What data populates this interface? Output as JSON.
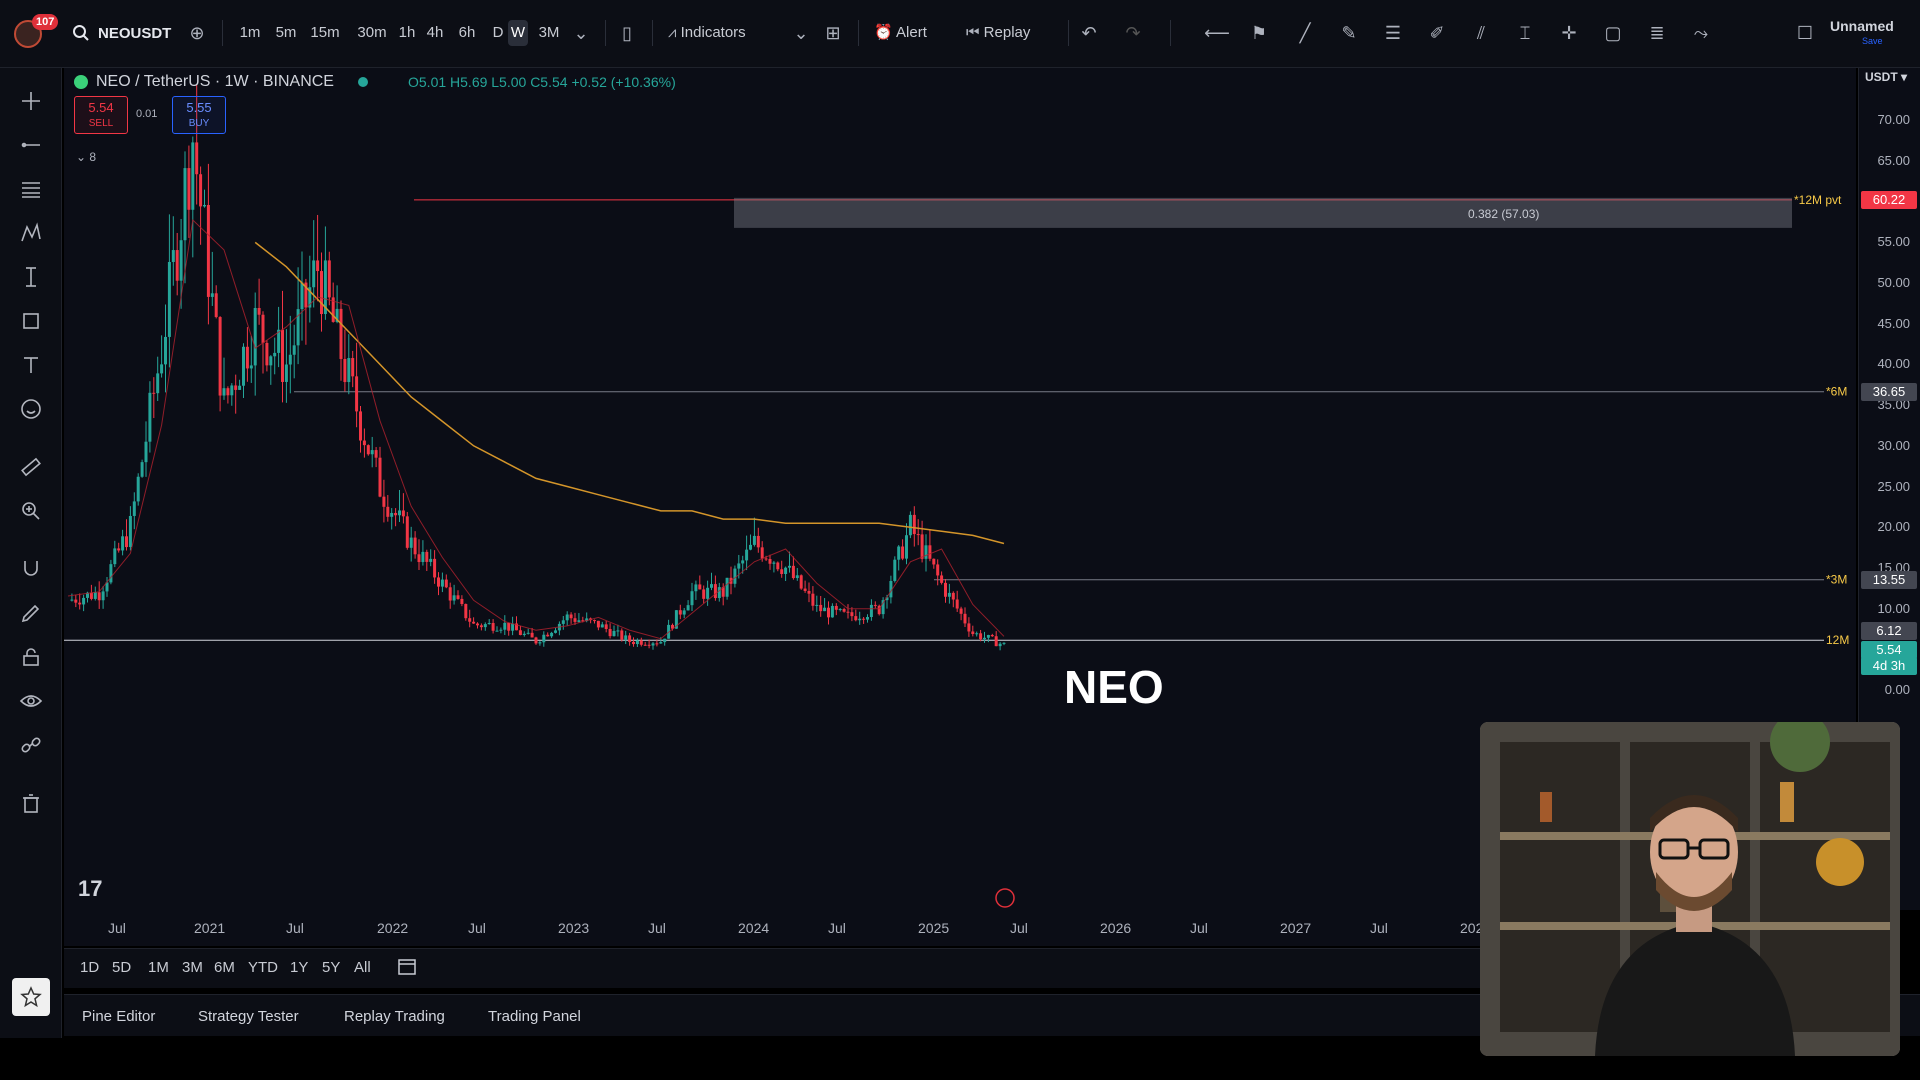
{
  "app": {
    "notification_count": "107",
    "symbol": "NEOUSDT",
    "timeframes": [
      "1m",
      "5m",
      "15m",
      "30m",
      "1h",
      "4h",
      "6h",
      "D",
      "W",
      "3M"
    ],
    "active_timeframe": "W",
    "indicators_label": "Indicators",
    "alert_label": "Alert",
    "replay_label": "Replay",
    "layout_name": "Unnamed",
    "layout_sub": "Save"
  },
  "legend": {
    "title": "NEO / TetherUS · 1W · BINANCE",
    "ohlc": "O5.01 H5.69 L5.00 C5.54 +0.52 (+10.36%)",
    "sell_price": "5.54",
    "sell_label": "SELL",
    "buy_price": "5.55",
    "buy_label": "BUY",
    "spread": "0.01",
    "indicators_collapsed": "8"
  },
  "chart_overlay": {
    "big_label": "NEO",
    "fib_label": "0.382 (57.03)",
    "level_12m_pvt": "*12M pvt",
    "level_6m": "*6M",
    "level_3m": "*3M",
    "level_12m": "12M"
  },
  "price_scale": {
    "currency": "USDT",
    "ticks": [
      "70.00",
      "65.00",
      "60.00",
      "55.00",
      "50.00",
      "45.00",
      "40.00",
      "35.00",
      "30.00",
      "25.00",
      "20.00",
      "15.00",
      "10.00",
      "5.00",
      "0.00"
    ],
    "tags": {
      "pvt_12m": "60.22",
      "lvl_6m": "36.65",
      "lvl_3m": "13.55",
      "lvl_12m": "6.12",
      "last": "5.54",
      "countdown": "4d 3h"
    },
    "colors": {
      "red": "#f23645",
      "green": "#26a69a",
      "gray": "#434651"
    }
  },
  "time_scale": [
    "Jul",
    "2021",
    "Jul",
    "2022",
    "Jul",
    "2023",
    "Jul",
    "2024",
    "Jul",
    "2025",
    "Jul",
    "2026",
    "Jul",
    "2027",
    "Jul",
    "2028"
  ],
  "range_bar": [
    "1D",
    "5D",
    "1M",
    "3M",
    "6M",
    "YTD",
    "1Y",
    "5Y",
    "All"
  ],
  "bottom_tabs": [
    "Pine Editor",
    "Strategy Tester",
    "Replay Trading",
    "Trading Panel"
  ],
  "chart_data": {
    "type": "candlestick",
    "symbol": "NEO / TetherUS",
    "interval": "1W",
    "ylim": [
      0,
      72
    ],
    "x": [
      "2020-07",
      "2020-10",
      "2021-01",
      "2021-03",
      "2021-04",
      "2021-05",
      "2021-06",
      "2021-08",
      "2021-09",
      "2021-11",
      "2022-01",
      "2022-03",
      "2022-05",
      "2022-07",
      "2022-09",
      "2022-12",
      "2023-02",
      "2023-04",
      "2023-07",
      "2023-09",
      "2023-11",
      "2024-01",
      "2024-03",
      "2024-04",
      "2024-06",
      "2024-08",
      "2024-10",
      "2024-12",
      "2025-02",
      "2025-04",
      "2025-06"
    ],
    "close": [
      11,
      12,
      20,
      42,
      68,
      35,
      45,
      40,
      52,
      38,
      25,
      18,
      13,
      8,
      8,
      6,
      9,
      8,
      6,
      6,
      12,
      12,
      18,
      15,
      10,
      9,
      10,
      20,
      13,
      7,
      5.54
    ],
    "series": [
      {
        "name": "MA",
        "values": [
          null,
          null,
          null,
          null,
          null,
          null,
          55,
          52,
          48,
          44,
          40,
          36,
          33,
          30,
          28,
          26,
          25,
          24,
          23,
          22,
          22,
          21,
          21,
          20.5,
          20.5,
          20.5,
          20.5,
          20,
          19.5,
          19,
          18
        ]
      }
    ],
    "levels": [
      {
        "name": "*12M pvt",
        "value": 60.22
      },
      {
        "name": "*6M",
        "value": 36.65
      },
      {
        "name": "*3M",
        "value": 13.55
      },
      {
        "name": "12M",
        "value": 6.12
      }
    ]
  }
}
